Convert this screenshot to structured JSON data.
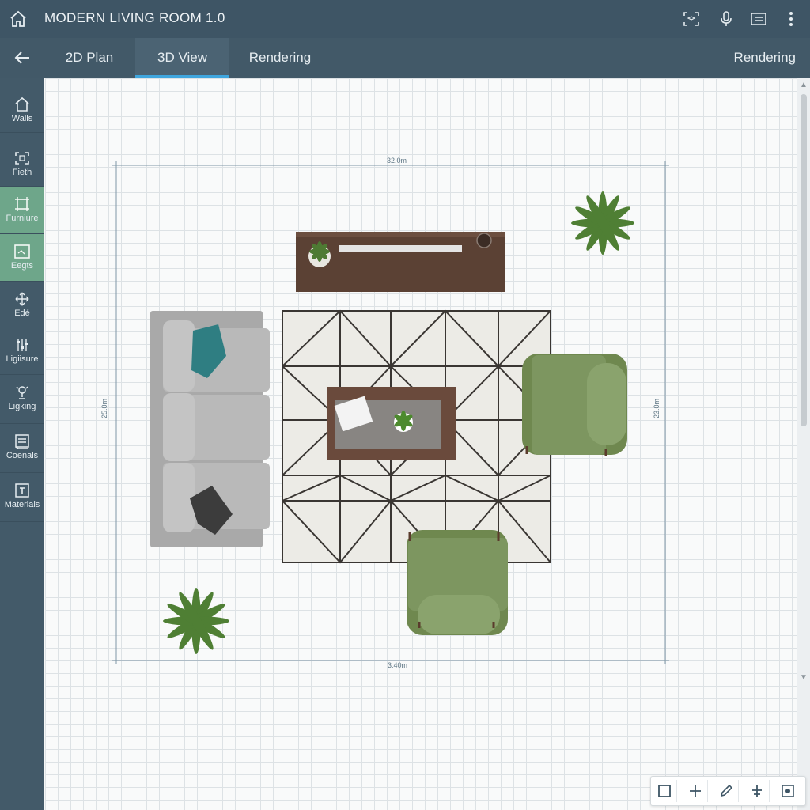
{
  "app": {
    "title": "MODERN LIVING ROOM 1.0"
  },
  "tabs": [
    {
      "label": "2D Plan"
    },
    {
      "label": "3D View"
    },
    {
      "label": "Rendering"
    }
  ],
  "tab_right_label": "Rendering",
  "active_tab": "3D View",
  "sidebar": {
    "items": [
      {
        "label": "Walls",
        "icon": "house-icon"
      },
      {
        "label": "Fieth",
        "icon": "scan-icon"
      },
      {
        "label": "Furniure",
        "icon": "frame-icon"
      },
      {
        "label": "Eegts",
        "icon": "picture-icon"
      },
      {
        "label": "Edé",
        "icon": "move-icon"
      },
      {
        "label": "Ligiisure",
        "icon": "sliders-icon"
      },
      {
        "label": "Ligking",
        "icon": "lamp-icon"
      },
      {
        "label": "Coenals",
        "icon": "layers-icon"
      },
      {
        "label": "Materials",
        "icon": "palette-icon"
      }
    ],
    "active": [
      "Furniure",
      "Eegts"
    ]
  },
  "plan": {
    "dimensions": {
      "top": "32.0m",
      "bottom": "3.40m",
      "left": "25.0m",
      "right": "23.0m"
    }
  },
  "colors": {
    "topbar": "#3e5565",
    "sidebar": "#435a69",
    "active_green": "#6ea68a",
    "tab_underline": "#3fa6de",
    "sofa": "#a9a9a9",
    "armchair": "#7d9660",
    "tv_stand": "#5b4134",
    "rug": "#ecebe6"
  },
  "toolbar": {
    "tools": [
      "select-square-icon",
      "add-plus-icon",
      "pencil-icon",
      "align-icon",
      "snap-target-icon"
    ]
  }
}
